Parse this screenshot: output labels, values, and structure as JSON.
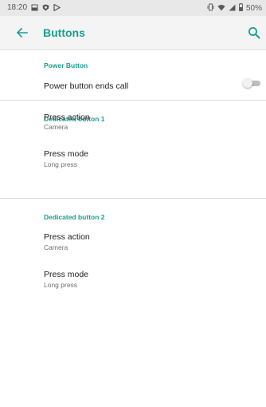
{
  "status_bar": {
    "time": "18:20",
    "battery": "50%"
  },
  "header": {
    "title": "Buttons"
  },
  "sections": [
    {
      "header": "Power Button",
      "items": [
        {
          "title": "Power button ends call",
          "toggle_on": false
        }
      ]
    },
    {
      "header": "Dedicated button 1",
      "items": [
        {
          "title": "Press action",
          "subtitle": "Camera"
        },
        {
          "title": "Press mode",
          "subtitle": "Long press"
        }
      ]
    },
    {
      "header": "Dedicated button 2",
      "items": [
        {
          "title": "Press action",
          "subtitle": "Camera"
        },
        {
          "title": "Press mode",
          "subtitle": "Long press"
        }
      ]
    }
  ],
  "colors": {
    "accent": "#1a9e8f",
    "status_bar_bg": "#e8e8e8",
    "app_bar_bg": "#f4f4f4"
  },
  "icons": {
    "back": "back-arrow-icon",
    "search": "search-icon",
    "status_left": [
      "image-icon",
      "shield-icon",
      "play-store-icon"
    ],
    "status_right": [
      "vibrate-icon",
      "wifi-icon",
      "signal-icon",
      "battery-icon"
    ]
  }
}
